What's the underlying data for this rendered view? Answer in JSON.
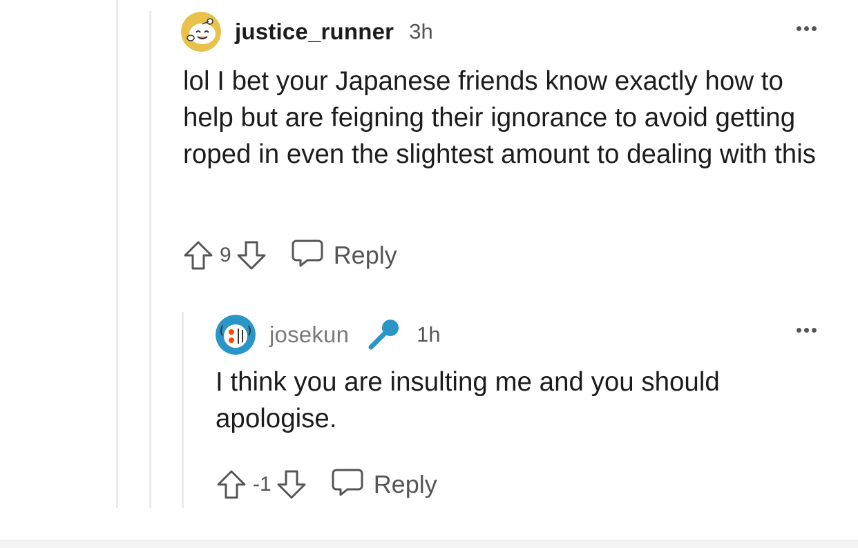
{
  "comments": [
    {
      "username": "justice_runner",
      "time": "3h",
      "body": "lol I bet your Japanese friends know exactly how to help but are feigning their ignorance to avoid getting roped in even the slightest amount to dealing with this",
      "score": "9",
      "reply_label": "Reply",
      "avatar_color": "#e8c24a"
    },
    {
      "username": "josekun",
      "time": "1h",
      "body": "I think you are insulting me and you should apologise.",
      "score": "-1",
      "reply_label": "Reply",
      "avatar_color": "#2a95c7",
      "flair_color": "#2a95c7"
    }
  ],
  "icons": {
    "upvote": "arrow-up-outline",
    "downvote": "arrow-down-outline",
    "reply": "speech-bubble",
    "more": "horizontal-ellipsis",
    "flair": "microphone"
  }
}
